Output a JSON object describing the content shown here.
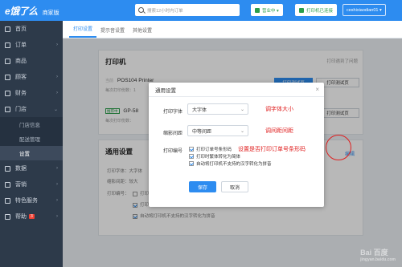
{
  "app": {
    "brand": "e饿了么",
    "edition": "商家版"
  },
  "topbar": {
    "search_placeholder": "搜索12小时内订单",
    "status_label": "营业中 ▾",
    "printer_status_label": "打印机已连接",
    "user_label": "ceshixiaodian01 ▾"
  },
  "sidebar": {
    "items": [
      {
        "label": "首页",
        "icon": "home-icon"
      },
      {
        "label": "订单",
        "icon": "order-icon",
        "arrow": "›"
      },
      {
        "label": "商品",
        "icon": "goods-icon"
      },
      {
        "label": "顾客",
        "icon": "customer-icon",
        "arrow": "›"
      },
      {
        "label": "财务",
        "icon": "finance-icon",
        "arrow": "›"
      },
      {
        "label": "门店",
        "icon": "store-icon",
        "arrow": "⌄"
      }
    ],
    "sub_items": [
      {
        "label": "门店信息"
      },
      {
        "label": "配送管理"
      },
      {
        "label": "设置"
      }
    ],
    "items_bottom": [
      {
        "label": "数据",
        "icon": "data-icon",
        "arrow": "›"
      },
      {
        "label": "营销",
        "icon": "marketing-icon",
        "arrow": "›"
      },
      {
        "label": "特色服务",
        "icon": "service-icon",
        "arrow": "›"
      },
      {
        "label": "帮助",
        "icon": "help-icon",
        "badge": "3",
        "arrow": "›"
      }
    ]
  },
  "tabs": [
    {
      "label": "打印设置",
      "active": true
    },
    {
      "label": "提示音设置",
      "active": false
    },
    {
      "label": "其他设置",
      "active": false
    }
  ],
  "printer_panel": {
    "title": "打印机",
    "faq_link": "打印遇到了问题",
    "printers": [
      {
        "name": "POS104 Printer",
        "prefix": "当前",
        "sub": "每次打印份数：1",
        "btn_primary": "打印测试页",
        "btn": "打印测试页"
      },
      {
        "name": "GP-58",
        "tag": "推荐中",
        "sub": "每次打印份数：",
        "btn": "打印测试页"
      }
    ]
  },
  "general_panel": {
    "title": "通用设置",
    "edit_link": "编辑",
    "font_line": "打印字体：大字体",
    "margin_line": "缩影间距：较大",
    "extra_line_label": "打印编号：",
    "options": [
      {
        "label": "打印订单号条形码",
        "checked": false
      },
      {
        "label": "打印时繁体转化为简体",
        "checked": true
      },
      {
        "label": "自动将打印机不支持的汉字转化为拼音",
        "checked": true
      }
    ]
  },
  "dialog": {
    "title": "通用设置",
    "close": "×",
    "font_label": "打印字体",
    "font_value": "大字体",
    "spacing_label": "缩影间距",
    "spacing_value": "中等间距",
    "extra_label": "打印编号",
    "options": [
      {
        "label": "打印订单号条形码",
        "checked": true
      },
      {
        "label": "打印时繁体转化为简体",
        "checked": true
      },
      {
        "label": "自动将打印机不支持的汉字转化为拼音",
        "checked": true
      }
    ],
    "save": "保存",
    "cancel": "取消"
  },
  "annotations": {
    "font_size": "调字体大小",
    "spacing": "调间距间距",
    "barcode": "设置是否打印订单号条形码"
  },
  "watermark": {
    "text": "Bai 百度",
    "sub": "jingyan.baidu.com"
  }
}
